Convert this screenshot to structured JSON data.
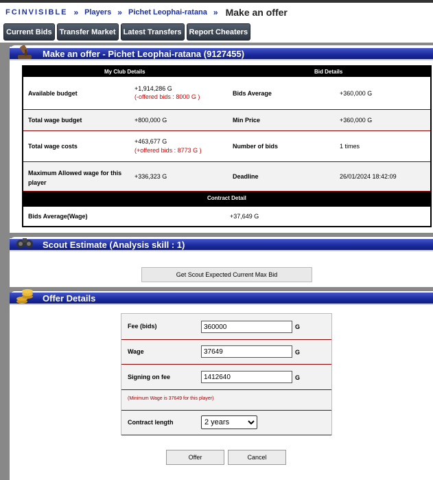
{
  "breadcrumb": {
    "brand": "FCINVISIBLE",
    "players": "Players",
    "player": "Pichet Leophai-ratana",
    "current": "Make an offer"
  },
  "tabs": [
    "Current Bids",
    "Transfer Market",
    "Latest Transfers",
    "Report Cheaters"
  ],
  "offer_panel": {
    "title": "Make an offer - Pichet Leophai-ratana (9127455)",
    "my_club_header": "My Club Details",
    "bid_header": "Bid Details",
    "rows": [
      {
        "label": "Available budget",
        "value": "+1,914,286 G",
        "note": "(-offered bids : 8000 G )",
        "bid_label": "Bids Average",
        "bid_value": "+360,000 G"
      },
      {
        "label": "Total wage budget",
        "value": "+800,000 G",
        "note": "",
        "bid_label": "Min Price",
        "bid_value": "+360,000 G"
      },
      {
        "label": "Total wage costs",
        "value": "+463,677 G",
        "note": "(+offered bids : 8773 G )",
        "bid_label": "Number of bids",
        "bid_value": "1 times"
      },
      {
        "label": "Maximum Allowed wage for this player",
        "value": "+336,323 G",
        "note": "",
        "bid_label": "Deadline",
        "bid_value": "26/01/2024 18:42:09"
      }
    ],
    "contract_header": "Contract Detail",
    "contract_label": "Bids Average(Wage)",
    "contract_value": "+37,649 G"
  },
  "scout": {
    "title": "Scout Estimate (Analysis skill : 1)",
    "button": "Get Scout Expected Current Max Bid"
  },
  "offer_details": {
    "title": "Offer Details",
    "fee_label": "Fee (bids)",
    "fee_value": "360000",
    "wage_label": "Wage",
    "wage_value": "37649",
    "signing_label": "Signing on fee",
    "signing_value": "1412640",
    "currency": "G",
    "min_wage_note": "(Minimum Wage is 37649 for this player)",
    "contract_label": "Contract length",
    "contract_value": "2 years",
    "offer_button": "Offer",
    "cancel_button": "Cancel"
  },
  "colors": {
    "header_blue": "#1a2a9c",
    "link_blue": "#1c2f9e",
    "note_red": "#d00000",
    "row_line": "#8b0000"
  }
}
